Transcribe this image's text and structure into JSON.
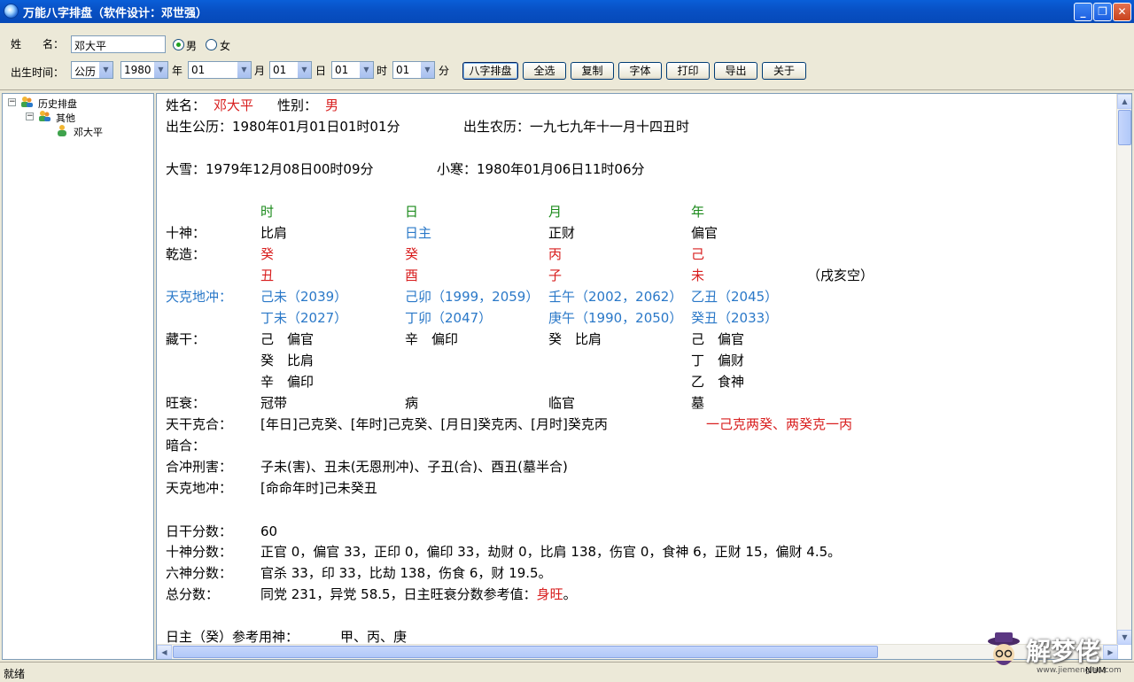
{
  "window": {
    "title": "万能八字排盘（软件设计：邓世强）"
  },
  "form": {
    "name_label": "姓　　名：",
    "name_value": "邓大平",
    "gender_male": "男",
    "gender_female": "女",
    "gender_selected": "male",
    "birth_label": "出生时间：",
    "calendar": "公历",
    "year": "1980",
    "year_unit": "年",
    "month": "01",
    "month_unit": "月",
    "day": "01",
    "day_unit": "日",
    "hour": "01",
    "hour_unit": "时",
    "minute": "01",
    "minute_unit": "分"
  },
  "buttons": {
    "bazi": "八字排盘",
    "select_all": "全选",
    "copy": "复制",
    "font": "字体",
    "print": "打印",
    "export": "导出",
    "about": "关于"
  },
  "tree": {
    "root": "历史排盘",
    "group": "其他",
    "leaf": "邓大平"
  },
  "report": {
    "name_label": "姓名：",
    "name": "邓大平",
    "gender_label": "性别：",
    "gender": "男",
    "solar": "出生公历：1980年01月01日01时01分",
    "lunar": "出生农历：一九七九年十一月十四丑时",
    "term1": "大雪：1979年12月08日00时09分",
    "term2": "小寒：1980年01月06日11时06分",
    "pillar_headers": [
      "时",
      "日",
      "月",
      "年"
    ],
    "shishen_label": "十神：",
    "shishen": [
      "比肩",
      "日主",
      "正财",
      "偏官"
    ],
    "qianzao_label": "乾造：",
    "stems": [
      "癸",
      "癸",
      "丙",
      "己"
    ],
    "branches": [
      "丑",
      "酉",
      "子",
      "未"
    ],
    "kongwang": "（戌亥空）",
    "tkdc_label": "天克地冲：",
    "tkdc_row1": [
      "己未（2039）",
      "己卯（1999，2059）",
      "壬午（2002，2062）",
      "乙丑（2045）"
    ],
    "tkdc_row2": [
      "丁未（2027）",
      "丁卯（2047）",
      "庚午（1990，2050）",
      "癸丑（2033）"
    ],
    "canggan_label": "藏干：",
    "canggan_row1": [
      "己　偏官",
      "辛　偏印",
      "癸　比肩",
      "己　偏官"
    ],
    "canggan_row2_hour": "癸　比肩",
    "canggan_row2_year": "丁　偏财",
    "canggan_row3_hour": "辛　偏印",
    "canggan_row3_year": "乙　食神",
    "wangshuai_label": "旺衰：",
    "wangshuai": [
      "冠带",
      "病",
      "临官",
      "墓"
    ],
    "tgkh_label": "天干克合：",
    "tgkh": "[年日]己克癸、[年时]己克癸、[月日]癸克丙、[月时]癸克丙",
    "tgkh_red": "一己克两癸、两癸克一丙",
    "anhe_label": "暗合：",
    "hcxh_label": "合冲刑害：",
    "hcxh": "子未(害)、丑未(无恩刑冲)、子丑(合)、酉丑(墓半合)",
    "tkdc2_label": "天克地冲：",
    "tkdc2": "[命命年时]己未癸丑",
    "rigan_label": "日干分数：",
    "rigan": "60",
    "shishen_score_label": "十神分数：",
    "shishen_score": "正官 0，偏官 33，正印 0，偏印 33，劫财 0，比肩 138，伤官 0，食神 6，正财 15，偏财 4.5。",
    "liushen_label": "六神分数：",
    "liushen": "官杀 33，印 33，比劫 138，伤食 6，财 19.5。",
    "total_label": "总分数：",
    "total": "同党 231，异党 58.5，日主旺衰分数参考值：",
    "total_red": "身旺",
    "total_end": "。",
    "yongshen_label": "日主（癸）参考用神：",
    "yongshen": "甲、丙、庚"
  },
  "status": {
    "text": "就绪",
    "num": "NUM"
  },
  "watermark": {
    "text": "解梦佬",
    "url": "www.jiemenglao.com"
  },
  "colors": {
    "red": "#d81e1e",
    "green": "#1b8a1b",
    "blue": "#2a78c8",
    "title_bar": "#0a5fd8"
  }
}
